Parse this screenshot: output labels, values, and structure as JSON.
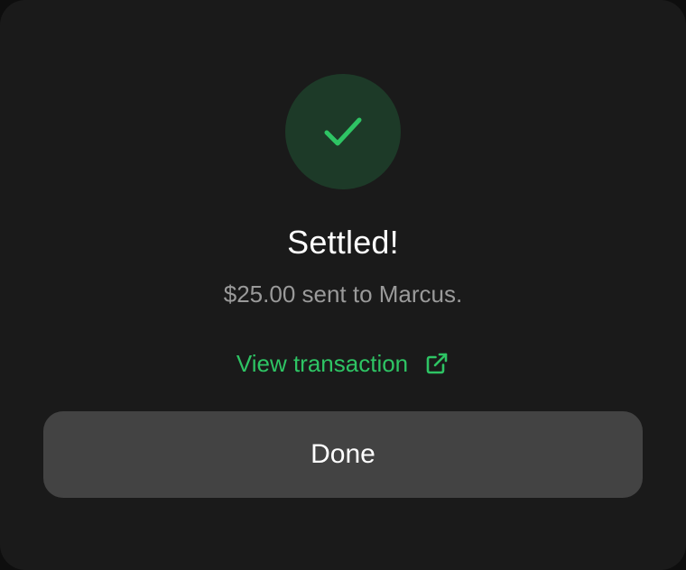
{
  "dialog": {
    "icon": "checkmark-icon",
    "title": "Settled!",
    "message": "$25.00 sent to Marcus.",
    "link": {
      "label": "View transaction",
      "icon": "external-link-icon"
    },
    "done_label": "Done"
  },
  "colors": {
    "background": "#1a1a1a",
    "badge_background": "#1d3a28",
    "accent_green": "#2ec464",
    "subtitle_gray": "#9a9a9a",
    "button_background": "#434343",
    "text_white": "#ffffff"
  }
}
